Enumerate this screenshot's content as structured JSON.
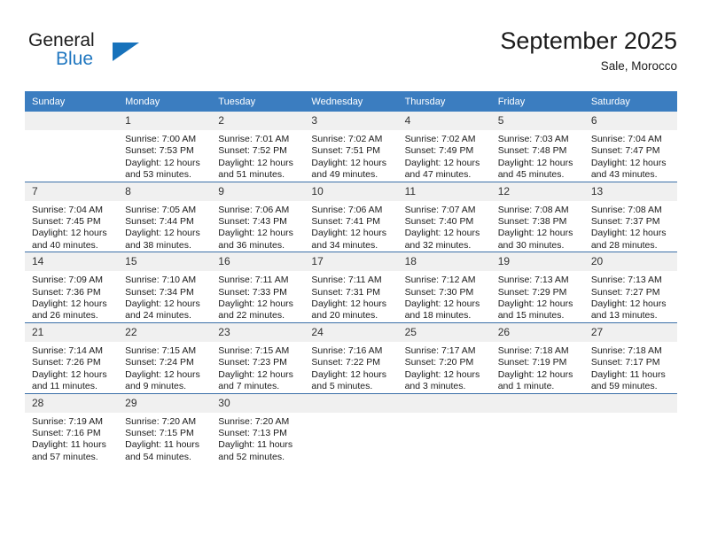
{
  "brand": {
    "name_part1": "General",
    "name_part2": "Blue",
    "accent_color": "#2077c0",
    "triangle_color": "#1772bb"
  },
  "header": {
    "title": "September 2025",
    "location": "Sale, Morocco"
  },
  "theme": {
    "header_row_bg": "#3b7dc0",
    "daynum_bg": "#f0f0f0",
    "row_divider": "#3b6fa8"
  },
  "weekday_headers": [
    "Sunday",
    "Monday",
    "Tuesday",
    "Wednesday",
    "Thursday",
    "Friday",
    "Saturday"
  ],
  "weeks": [
    [
      {
        "day": "",
        "sunrise": "",
        "sunset": "",
        "daylight1": "",
        "daylight2": ""
      },
      {
        "day": "1",
        "sunrise": "Sunrise: 7:00 AM",
        "sunset": "Sunset: 7:53 PM",
        "daylight1": "Daylight: 12 hours",
        "daylight2": "and 53 minutes."
      },
      {
        "day": "2",
        "sunrise": "Sunrise: 7:01 AM",
        "sunset": "Sunset: 7:52 PM",
        "daylight1": "Daylight: 12 hours",
        "daylight2": "and 51 minutes."
      },
      {
        "day": "3",
        "sunrise": "Sunrise: 7:02 AM",
        "sunset": "Sunset: 7:51 PM",
        "daylight1": "Daylight: 12 hours",
        "daylight2": "and 49 minutes."
      },
      {
        "day": "4",
        "sunrise": "Sunrise: 7:02 AM",
        "sunset": "Sunset: 7:49 PM",
        "daylight1": "Daylight: 12 hours",
        "daylight2": "and 47 minutes."
      },
      {
        "day": "5",
        "sunrise": "Sunrise: 7:03 AM",
        "sunset": "Sunset: 7:48 PM",
        "daylight1": "Daylight: 12 hours",
        "daylight2": "and 45 minutes."
      },
      {
        "day": "6",
        "sunrise": "Sunrise: 7:04 AM",
        "sunset": "Sunset: 7:47 PM",
        "daylight1": "Daylight: 12 hours",
        "daylight2": "and 43 minutes."
      }
    ],
    [
      {
        "day": "7",
        "sunrise": "Sunrise: 7:04 AM",
        "sunset": "Sunset: 7:45 PM",
        "daylight1": "Daylight: 12 hours",
        "daylight2": "and 40 minutes."
      },
      {
        "day": "8",
        "sunrise": "Sunrise: 7:05 AM",
        "sunset": "Sunset: 7:44 PM",
        "daylight1": "Daylight: 12 hours",
        "daylight2": "and 38 minutes."
      },
      {
        "day": "9",
        "sunrise": "Sunrise: 7:06 AM",
        "sunset": "Sunset: 7:43 PM",
        "daylight1": "Daylight: 12 hours",
        "daylight2": "and 36 minutes."
      },
      {
        "day": "10",
        "sunrise": "Sunrise: 7:06 AM",
        "sunset": "Sunset: 7:41 PM",
        "daylight1": "Daylight: 12 hours",
        "daylight2": "and 34 minutes."
      },
      {
        "day": "11",
        "sunrise": "Sunrise: 7:07 AM",
        "sunset": "Sunset: 7:40 PM",
        "daylight1": "Daylight: 12 hours",
        "daylight2": "and 32 minutes."
      },
      {
        "day": "12",
        "sunrise": "Sunrise: 7:08 AM",
        "sunset": "Sunset: 7:38 PM",
        "daylight1": "Daylight: 12 hours",
        "daylight2": "and 30 minutes."
      },
      {
        "day": "13",
        "sunrise": "Sunrise: 7:08 AM",
        "sunset": "Sunset: 7:37 PM",
        "daylight1": "Daylight: 12 hours",
        "daylight2": "and 28 minutes."
      }
    ],
    [
      {
        "day": "14",
        "sunrise": "Sunrise: 7:09 AM",
        "sunset": "Sunset: 7:36 PM",
        "daylight1": "Daylight: 12 hours",
        "daylight2": "and 26 minutes."
      },
      {
        "day": "15",
        "sunrise": "Sunrise: 7:10 AM",
        "sunset": "Sunset: 7:34 PM",
        "daylight1": "Daylight: 12 hours",
        "daylight2": "and 24 minutes."
      },
      {
        "day": "16",
        "sunrise": "Sunrise: 7:11 AM",
        "sunset": "Sunset: 7:33 PM",
        "daylight1": "Daylight: 12 hours",
        "daylight2": "and 22 minutes."
      },
      {
        "day": "17",
        "sunrise": "Sunrise: 7:11 AM",
        "sunset": "Sunset: 7:31 PM",
        "daylight1": "Daylight: 12 hours",
        "daylight2": "and 20 minutes."
      },
      {
        "day": "18",
        "sunrise": "Sunrise: 7:12 AM",
        "sunset": "Sunset: 7:30 PM",
        "daylight1": "Daylight: 12 hours",
        "daylight2": "and 18 minutes."
      },
      {
        "day": "19",
        "sunrise": "Sunrise: 7:13 AM",
        "sunset": "Sunset: 7:29 PM",
        "daylight1": "Daylight: 12 hours",
        "daylight2": "and 15 minutes."
      },
      {
        "day": "20",
        "sunrise": "Sunrise: 7:13 AM",
        "sunset": "Sunset: 7:27 PM",
        "daylight1": "Daylight: 12 hours",
        "daylight2": "and 13 minutes."
      }
    ],
    [
      {
        "day": "21",
        "sunrise": "Sunrise: 7:14 AM",
        "sunset": "Sunset: 7:26 PM",
        "daylight1": "Daylight: 12 hours",
        "daylight2": "and 11 minutes."
      },
      {
        "day": "22",
        "sunrise": "Sunrise: 7:15 AM",
        "sunset": "Sunset: 7:24 PM",
        "daylight1": "Daylight: 12 hours",
        "daylight2": "and 9 minutes."
      },
      {
        "day": "23",
        "sunrise": "Sunrise: 7:15 AM",
        "sunset": "Sunset: 7:23 PM",
        "daylight1": "Daylight: 12 hours",
        "daylight2": "and 7 minutes."
      },
      {
        "day": "24",
        "sunrise": "Sunrise: 7:16 AM",
        "sunset": "Sunset: 7:22 PM",
        "daylight1": "Daylight: 12 hours",
        "daylight2": "and 5 minutes."
      },
      {
        "day": "25",
        "sunrise": "Sunrise: 7:17 AM",
        "sunset": "Sunset: 7:20 PM",
        "daylight1": "Daylight: 12 hours",
        "daylight2": "and 3 minutes."
      },
      {
        "day": "26",
        "sunrise": "Sunrise: 7:18 AM",
        "sunset": "Sunset: 7:19 PM",
        "daylight1": "Daylight: 12 hours",
        "daylight2": "and 1 minute."
      },
      {
        "day": "27",
        "sunrise": "Sunrise: 7:18 AM",
        "sunset": "Sunset: 7:17 PM",
        "daylight1": "Daylight: 11 hours",
        "daylight2": "and 59 minutes."
      }
    ],
    [
      {
        "day": "28",
        "sunrise": "Sunrise: 7:19 AM",
        "sunset": "Sunset: 7:16 PM",
        "daylight1": "Daylight: 11 hours",
        "daylight2": "and 57 minutes."
      },
      {
        "day": "29",
        "sunrise": "Sunrise: 7:20 AM",
        "sunset": "Sunset: 7:15 PM",
        "daylight1": "Daylight: 11 hours",
        "daylight2": "and 54 minutes."
      },
      {
        "day": "30",
        "sunrise": "Sunrise: 7:20 AM",
        "sunset": "Sunset: 7:13 PM",
        "daylight1": "Daylight: 11 hours",
        "daylight2": "and 52 minutes."
      },
      {
        "day": "",
        "sunrise": "",
        "sunset": "",
        "daylight1": "",
        "daylight2": ""
      },
      {
        "day": "",
        "sunrise": "",
        "sunset": "",
        "daylight1": "",
        "daylight2": ""
      },
      {
        "day": "",
        "sunrise": "",
        "sunset": "",
        "daylight1": "",
        "daylight2": ""
      },
      {
        "day": "",
        "sunrise": "",
        "sunset": "",
        "daylight1": "",
        "daylight2": ""
      }
    ]
  ]
}
